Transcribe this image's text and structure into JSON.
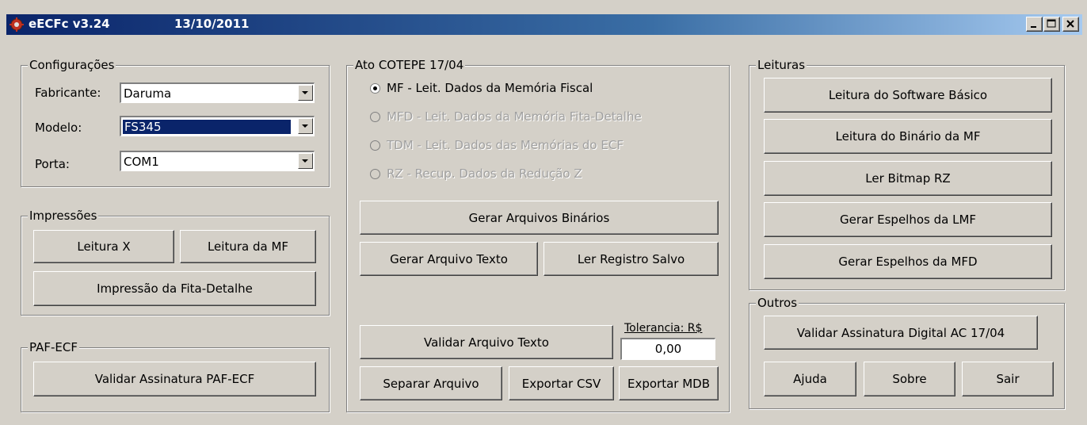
{
  "window": {
    "title": "eECFc v3.24",
    "date": "13/10/2011"
  },
  "config": {
    "legend": "Configurações",
    "fabricante_label": "Fabricante:",
    "fabricante_value": "Daruma",
    "modelo_label": "Modelo:",
    "modelo_value": "FS345",
    "porta_label": "Porta:",
    "porta_value": "COM1"
  },
  "impressoes": {
    "legend": "Impressões",
    "leitura_x": "Leitura X",
    "leitura_mf": "Leitura da MF",
    "fita_detalhe": "Impressão da Fita-Detalhe"
  },
  "paf": {
    "legend": "PAF-ECF",
    "validar": "Validar Assinatura PAF-ECF"
  },
  "ato": {
    "legend": "Ato COTEPE 17/04",
    "radios": [
      {
        "label": "MF - Leit. Dados da Memória Fiscal",
        "checked": true,
        "enabled": true
      },
      {
        "label": "MFD - Leit. Dados da Memória Fita-Detalhe",
        "checked": false,
        "enabled": false
      },
      {
        "label": "TDM - Leit. Dados das Memórias do ECF",
        "checked": false,
        "enabled": false
      },
      {
        "label": "RZ - Recup. Dados da Redução Z",
        "checked": false,
        "enabled": false
      }
    ],
    "gerar_binarios": "Gerar Arquivos Binários",
    "gerar_texto": "Gerar Arquivo Texto",
    "ler_registro": "Ler Registro Salvo",
    "validar_texto": "Validar Arquivo Texto",
    "tolerancia_label": "Tolerancia: R$",
    "tolerancia_value": "0,00",
    "separar": "Separar Arquivo",
    "exportar_csv": "Exportar CSV",
    "exportar_mdb": "Exportar MDB"
  },
  "leituras": {
    "legend": "Leituras",
    "software_basico": "Leitura do Software Básico",
    "binario_mf": "Leitura do Binário da MF",
    "bitmap_rz": "Ler Bitmap RZ",
    "espelhos_lmf": "Gerar Espelhos da LMF",
    "espelhos_mfd": "Gerar Espelhos da MFD"
  },
  "outros": {
    "legend": "Outros",
    "validar_ac": "Validar Assinatura Digital AC 17/04",
    "ajuda": "Ajuda",
    "sobre": "Sobre",
    "sair": "Sair"
  }
}
